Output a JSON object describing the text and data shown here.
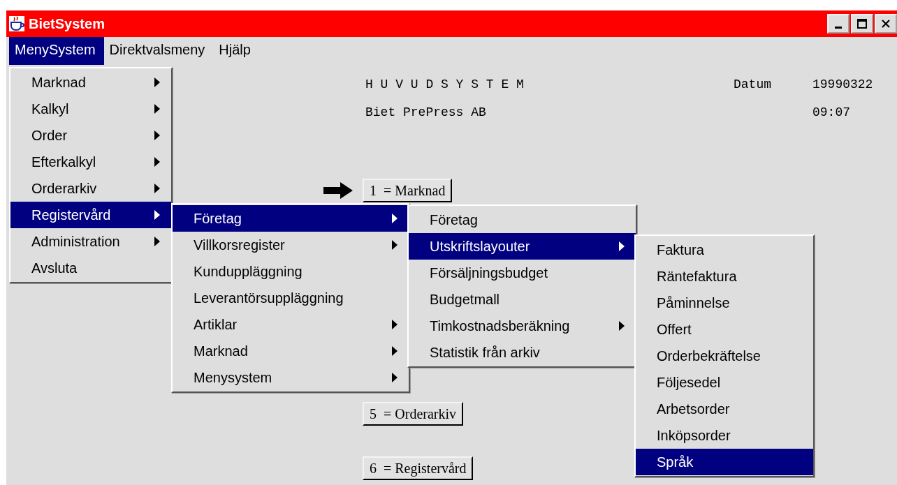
{
  "window": {
    "title": "BietSystem"
  },
  "menubar": [
    {
      "label": "MenySystem",
      "selected": true
    },
    {
      "label": "Direktvalsmeny",
      "selected": false
    },
    {
      "label": "Hjälp",
      "selected": false
    }
  ],
  "header": {
    "title": "H U V U D S Y S T E M",
    "company": "Biet PrePress AB",
    "date_label": "Datum",
    "date": "19990322",
    "time": "09:07"
  },
  "buttons": [
    {
      "label": "1  = Marknad"
    },
    {
      "label": "5  = Orderarkiv"
    },
    {
      "label": "6  = Registervård"
    }
  ],
  "menus": [
    {
      "items": [
        {
          "label": "Marknad",
          "selected": false,
          "submenu": true
        },
        {
          "label": "Kalkyl",
          "selected": false,
          "submenu": true
        },
        {
          "label": "Order",
          "selected": false,
          "submenu": true
        },
        {
          "label": "Efterkalkyl",
          "selected": false,
          "submenu": true
        },
        {
          "label": "Orderarkiv",
          "selected": false,
          "submenu": true
        },
        {
          "label": "Registervård",
          "selected": true,
          "submenu": true
        },
        {
          "label": "Administration",
          "selected": false,
          "submenu": true
        },
        {
          "label": "Avsluta",
          "selected": false,
          "submenu": false
        }
      ]
    },
    {
      "items": [
        {
          "label": "Företag",
          "selected": true,
          "submenu": true
        },
        {
          "label": "Villkorsregister",
          "selected": false,
          "submenu": true
        },
        {
          "label": "Kunduppläggning",
          "selected": false,
          "submenu": false
        },
        {
          "label": "Leverantörsuppläggning",
          "selected": false,
          "submenu": false
        },
        {
          "label": "Artiklar",
          "selected": false,
          "submenu": true
        },
        {
          "label": "Marknad",
          "selected": false,
          "submenu": true
        },
        {
          "label": "Menysystem",
          "selected": false,
          "submenu": true
        }
      ]
    },
    {
      "items": [
        {
          "label": "Företag",
          "selected": false,
          "submenu": false
        },
        {
          "label": "Utskriftslayouter",
          "selected": true,
          "submenu": true
        },
        {
          "label": "Försäljningsbudget",
          "selected": false,
          "submenu": false
        },
        {
          "label": "Budgetmall",
          "selected": false,
          "submenu": false
        },
        {
          "label": "Timkostnadsberäkning",
          "selected": false,
          "submenu": true
        },
        {
          "label": "Statistik från arkiv",
          "selected": false,
          "submenu": false
        }
      ]
    },
    {
      "items": [
        {
          "label": "Faktura",
          "selected": false,
          "submenu": false
        },
        {
          "label": "Räntefaktura",
          "selected": false,
          "submenu": false
        },
        {
          "label": "Påminnelse",
          "selected": false,
          "submenu": false
        },
        {
          "label": "Offert",
          "selected": false,
          "submenu": false
        },
        {
          "label": "Orderbekräftelse",
          "selected": false,
          "submenu": false
        },
        {
          "label": "Följesedel",
          "selected": false,
          "submenu": false
        },
        {
          "label": "Arbetsorder",
          "selected": false,
          "submenu": false
        },
        {
          "label": "Inköpsorder",
          "selected": false,
          "submenu": false
        },
        {
          "label": "Språk",
          "selected": true,
          "submenu": false
        }
      ]
    }
  ]
}
